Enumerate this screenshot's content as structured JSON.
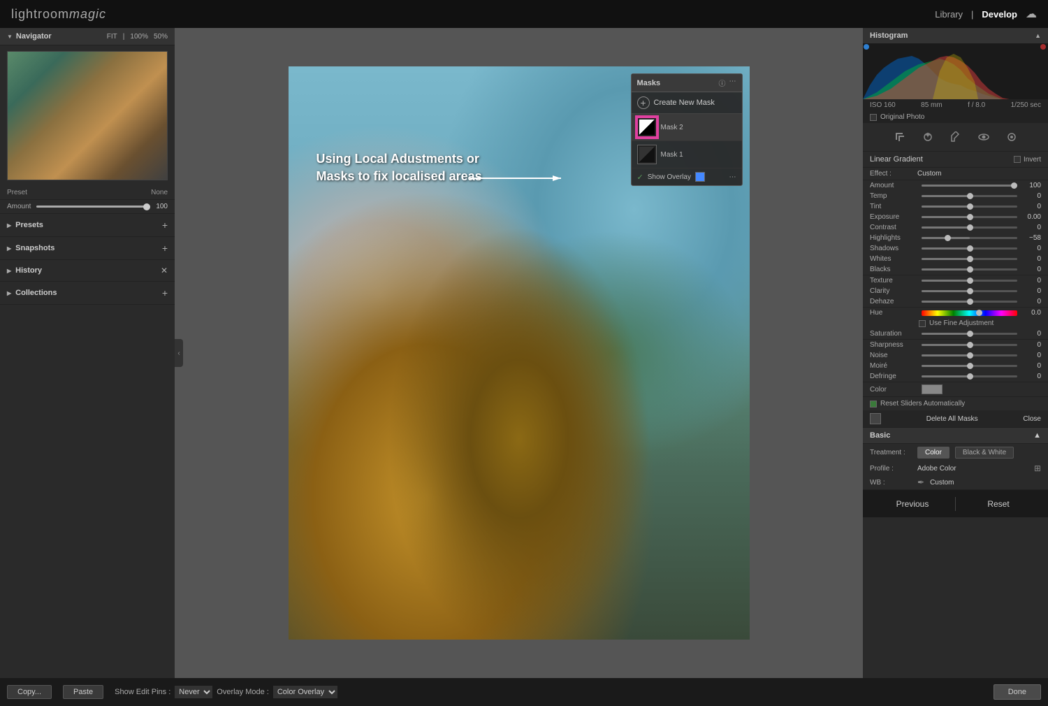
{
  "app": {
    "logo": "lightroommagic",
    "nav_library": "Library",
    "nav_separator": "|",
    "nav_develop": "Develop"
  },
  "top_bar": {
    "logo": "lightroommagic",
    "nav": [
      "Library",
      "|",
      "Develop"
    ]
  },
  "navigator": {
    "title": "Navigator",
    "fit_label": "FIT",
    "percent_100": "100%",
    "percent_50": "50%"
  },
  "preset_row": {
    "label": "Preset",
    "value": "None"
  },
  "amount_row": {
    "label": "Amount",
    "value": "100"
  },
  "sidebar": {
    "presets": "Presets",
    "snapshots": "Snapshots",
    "history": "History",
    "collections": "Collections"
  },
  "masks_panel": {
    "title": "Masks",
    "create_new": "Create New Mask",
    "mask2_label": "Mask 2",
    "mask1_label": "Mask 1",
    "show_overlay": "Show Overlay"
  },
  "overlay_text": {
    "line1": "Using Local Adustments or",
    "line2": "Masks to fix localised areas"
  },
  "histogram": {
    "title": "Histogram",
    "iso": "ISO 160",
    "focal": "85 mm",
    "aperture": "f / 8.0",
    "shutter": "1/250 sec"
  },
  "original_photo": {
    "label": "Original Photo"
  },
  "linear_gradient": {
    "label": "Linear Gradient",
    "invert": "Invert"
  },
  "effect": {
    "label": "Effect :",
    "value": "Custom"
  },
  "sliders": {
    "amount": {
      "label": "Amount",
      "value": "100"
    },
    "temp": {
      "label": "Temp",
      "value": "0"
    },
    "tint": {
      "label": "Tint",
      "value": "0"
    },
    "exposure": {
      "label": "Exposure",
      "value": "0.00"
    },
    "contrast": {
      "label": "Contrast",
      "value": "0"
    },
    "highlights": {
      "label": "Highlights",
      "value": "−58"
    },
    "shadows": {
      "label": "Shadows",
      "value": "0"
    },
    "whites": {
      "label": "Whites",
      "value": "0"
    },
    "blacks": {
      "label": "Blacks",
      "value": "0"
    },
    "texture": {
      "label": "Texture",
      "value": "0"
    },
    "clarity": {
      "label": "Clarity",
      "value": "0"
    },
    "dehaze": {
      "label": "Dehaze",
      "value": "0"
    },
    "hue": {
      "label": "Hue",
      "value": "0.0"
    },
    "saturation": {
      "label": "Saturation",
      "value": "0"
    },
    "sharpness": {
      "label": "Sharpness",
      "value": "0"
    },
    "noise": {
      "label": "Noise",
      "value": "0"
    },
    "moire": {
      "label": "Moiré",
      "value": "0"
    },
    "defringe": {
      "label": "Defringe",
      "value": "0"
    }
  },
  "fine_adjustment": {
    "label": "Use Fine Adjustment"
  },
  "color": {
    "label": "Color"
  },
  "reset_sliders": {
    "label": "Reset Sliders Automatically"
  },
  "mask_actions": {
    "delete_all": "Delete All Masks",
    "close": "Close"
  },
  "basic": {
    "title": "Basic"
  },
  "treatment": {
    "label": "Treatment :",
    "color": "Color",
    "bw": "Black & White"
  },
  "profile": {
    "label": "Profile :",
    "value": "Adobe Color"
  },
  "wb": {
    "label": "WB :",
    "value": "Custom"
  },
  "bottom": {
    "copy": "Copy...",
    "paste": "Paste",
    "show_edit_pins": "Show Edit Pins :",
    "never": "Never",
    "overlay_mode": "Overlay Mode :",
    "color_overlay": "Color Overlay",
    "done": "Done"
  },
  "footer": {
    "previous": "Previous",
    "reset": "Reset"
  }
}
